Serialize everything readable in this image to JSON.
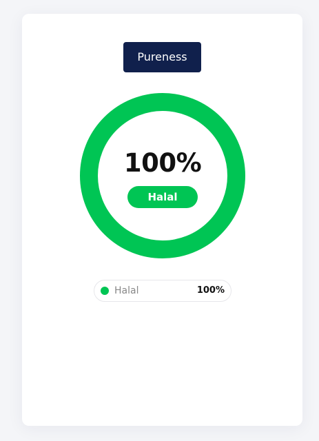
{
  "header": {
    "title_button": "Pureness"
  },
  "chart_data": {
    "type": "pie",
    "title": "",
    "center_value": "100%",
    "center_badge": "Halal",
    "series": [
      {
        "name": "Halal",
        "value": 100,
        "color": "#00c554"
      }
    ]
  },
  "legend": {
    "items": [
      {
        "label": "Halal",
        "value": "100%",
        "color": "#00c554"
      }
    ]
  },
  "colors": {
    "accent": "#00c554",
    "title_bg": "#10204c"
  }
}
